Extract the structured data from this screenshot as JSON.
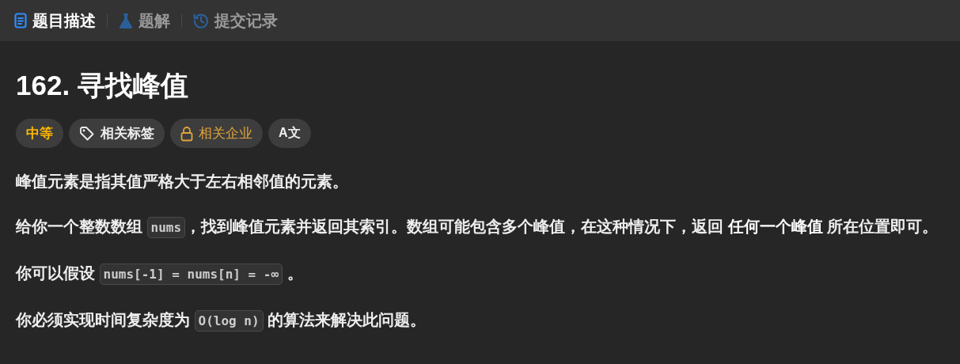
{
  "tabs": [
    {
      "label": "题目描述",
      "kind": "document",
      "selected": true
    },
    {
      "label": "题解",
      "kind": "flask",
      "selected": false
    },
    {
      "label": "提交记录",
      "kind": "history",
      "selected": false
    }
  ],
  "title": "162. 寻找峰值",
  "chips": [
    {
      "kind": "difficulty",
      "label": "中等"
    },
    {
      "kind": "tag",
      "label": "相关标签"
    },
    {
      "kind": "company",
      "label": "相关企业"
    },
    {
      "kind": "translate",
      "label": "A文"
    }
  ],
  "paragraphs": [
    [
      {
        "kind": "text",
        "text": "峰值元素是指其值严格大于左右相邻值的元素。"
      }
    ],
    [
      {
        "kind": "text",
        "text": "给你一个整数数组 "
      },
      {
        "kind": "code",
        "text": "nums"
      },
      {
        "kind": "text",
        "text": "，找到峰值元素并返回其索引。数组可能包含多个峰值，在这种情况下，返回 **任何一个峰值** 所在位置即可。"
      }
    ],
    [
      {
        "kind": "text",
        "text": "你可以假设 "
      },
      {
        "kind": "code",
        "text": "nums[-1] = nums[n] = -∞"
      },
      {
        "kind": "text",
        "text": " 。"
      }
    ],
    [
      {
        "kind": "text",
        "text": "你必须实现时间复杂度为 "
      },
      {
        "kind": "code",
        "text": "O(log n)"
      },
      {
        "kind": "text",
        "text": " 的算法来解决此问题。"
      }
    ]
  ]
}
